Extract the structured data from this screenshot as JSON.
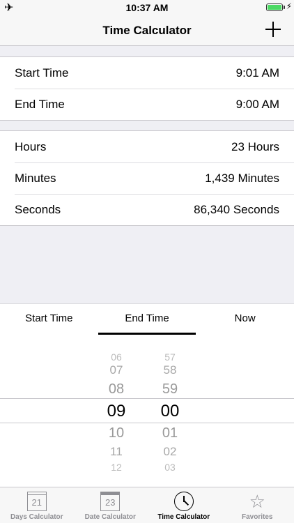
{
  "status_bar": {
    "time": "10:37 AM",
    "airplane_icon": "✈",
    "charging_icon": "⚡"
  },
  "nav": {
    "title": "Time Calculator"
  },
  "inputs": {
    "start_label": "Start Time",
    "start_value": "9:01 AM",
    "end_label": "End Time",
    "end_value": "9:00 AM"
  },
  "results": {
    "hours_label": "Hours",
    "hours_value": "23 Hours",
    "minutes_label": "Minutes",
    "minutes_value": "1,439 Minutes",
    "seconds_label": "Seconds",
    "seconds_value": "86,340 Seconds"
  },
  "segment": {
    "start": "Start Time",
    "end": "End Time",
    "now": "Now",
    "selected": "End Time"
  },
  "picker": {
    "hours": [
      "06",
      "07",
      "08",
      "09",
      "10",
      "11",
      "12"
    ],
    "minutes": [
      "57",
      "58",
      "59",
      "00",
      "01",
      "02",
      "03"
    ]
  },
  "tabs": {
    "days": "Days Calculator",
    "days_icon_num": "21",
    "date": "Date Calculator",
    "date_icon_num": "23",
    "time": "Time Calculator",
    "favorites": "Favorites",
    "favorites_icon": "☆"
  }
}
